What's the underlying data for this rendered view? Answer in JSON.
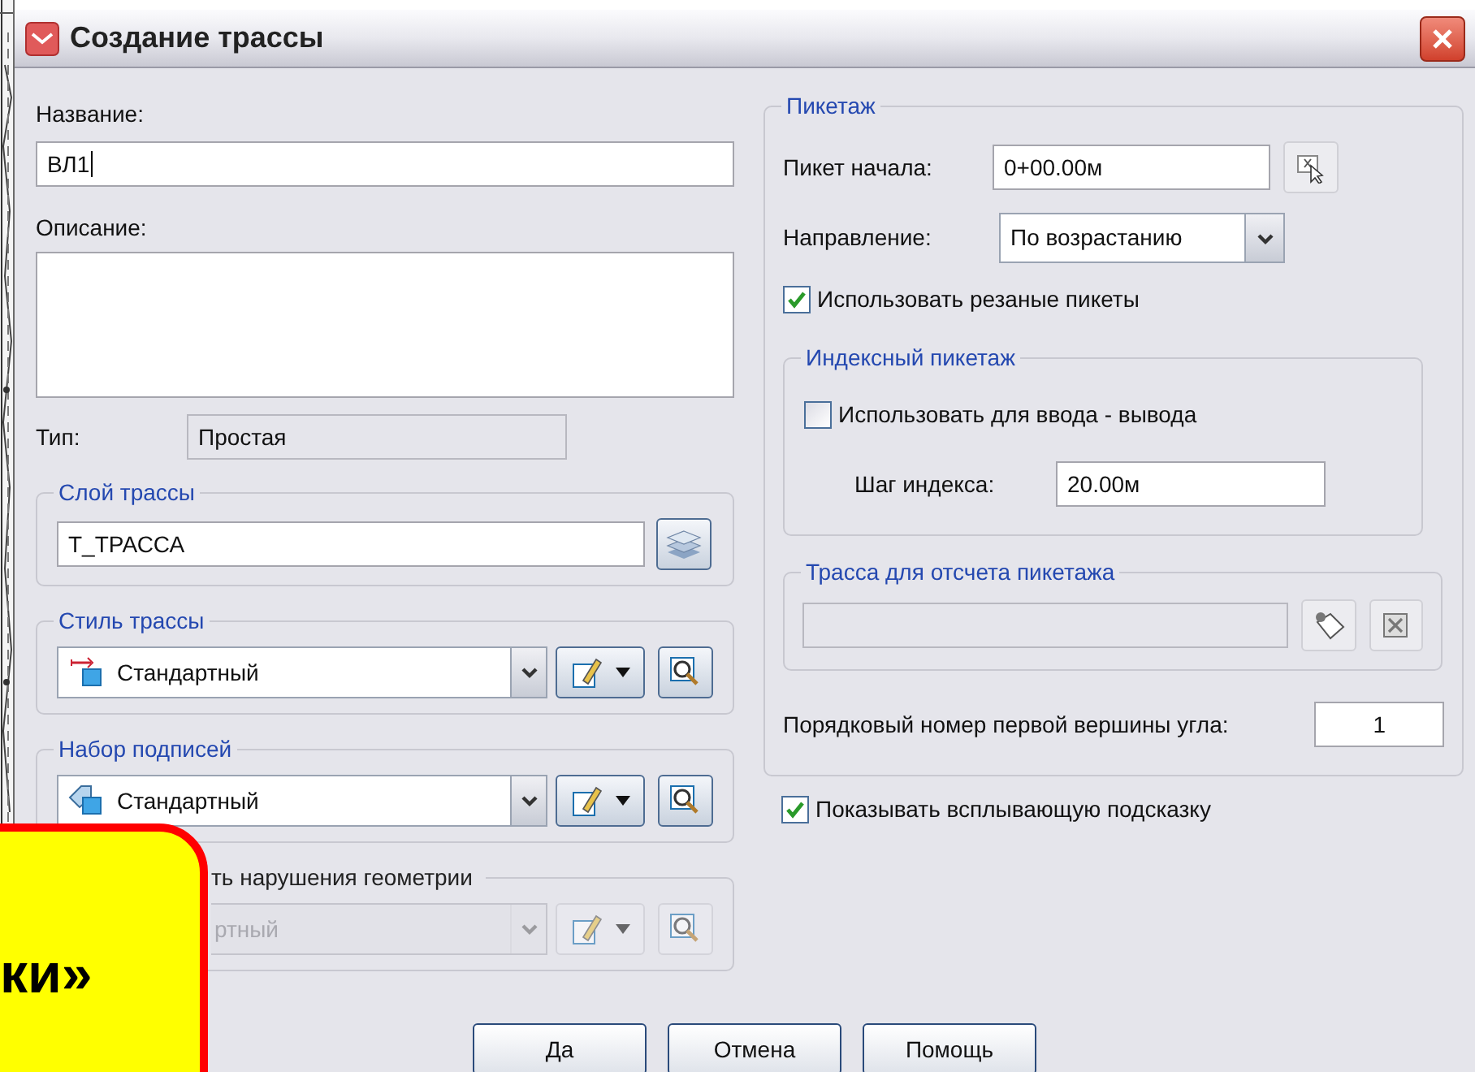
{
  "window": {
    "title": "Создание трассы"
  },
  "name_field": {
    "label": "Название:",
    "value": "ВЛ1"
  },
  "description_field": {
    "label": "Описание:"
  },
  "type_field": {
    "label": "Тип:",
    "value": "Простая"
  },
  "layer_group": {
    "title": "Слой трассы",
    "value": "Т_ТРАССА"
  },
  "style_groups": [
    {
      "kind": "style",
      "title": "Стиль трассы",
      "value": "Стандартный",
      "disabled": false
    },
    {
      "kind": "labels",
      "title": "Набор подписей",
      "value": "Стандартный",
      "disabled": false
    },
    {
      "kind": "covered",
      "title": "ть нарушения геометрии",
      "value": "ртный",
      "disabled": true
    }
  ],
  "stationing": {
    "title": "Пикетаж",
    "start_label": "Пикет начала:",
    "start_value": "0+00.00м",
    "direction_label": "Направление:",
    "direction_value": "По возрастанию",
    "use_cut": {
      "label": "Использовать резаные пикеты",
      "checked": true
    },
    "index_group": {
      "title": "Индексный пикетаж",
      "use_io": {
        "label": "Использовать для ввода - вывода",
        "checked": false
      },
      "step_label": "Шаг индекса:",
      "step_value": "20.00м"
    },
    "reference_group": {
      "title": "Трасса для отсчета пикетажа"
    },
    "first_vertex_label": "Порядковый номер первой вершины угла:",
    "first_vertex_value": "1"
  },
  "show_tooltip": {
    "label": "Показывать всплывающую подсказку",
    "checked": true
  },
  "buttons": [
    "Да",
    "Отмена",
    "Помощь"
  ],
  "overlay_note": {
    "text": "ки»"
  }
}
